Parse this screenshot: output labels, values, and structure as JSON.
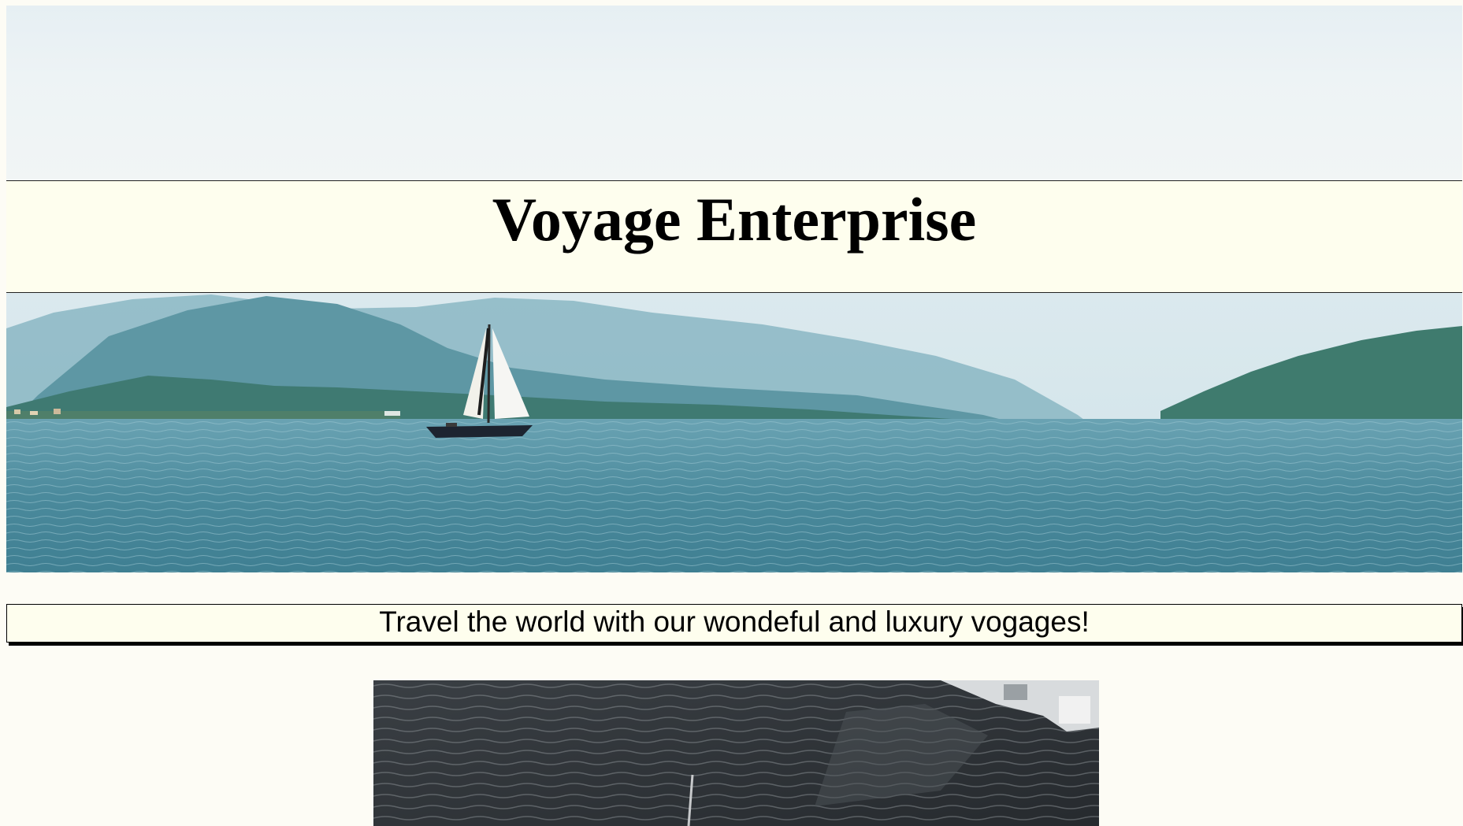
{
  "header": {
    "title": "Voyage Enterprise"
  },
  "hero": {
    "image_subject": "sailboat on lake with mountains"
  },
  "tagline": {
    "text": "Travel the world with our wondeful and luxury vogages!"
  },
  "gallery": {
    "image_subject": "dark water with boat reflections"
  },
  "colors": {
    "page_background": "#fdfcf5",
    "band_background": "#fefeee",
    "sky": "#e9f1f4",
    "water": "#4f8ea0",
    "mountains": "#5d97a4",
    "text": "#000000"
  }
}
